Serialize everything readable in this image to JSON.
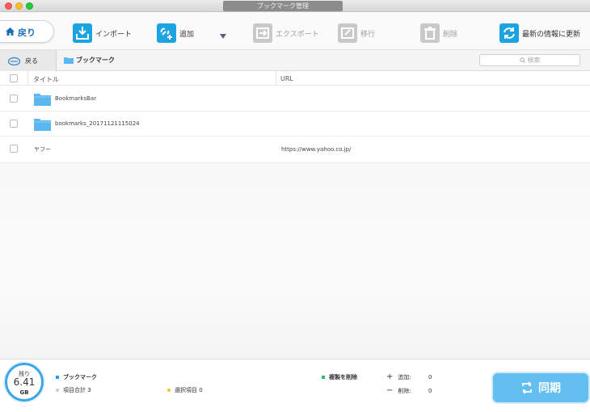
{
  "window": {
    "title": "ブックマーク管理"
  },
  "toolbar": {
    "back_label": "戻り",
    "import_label": "インポート",
    "add_label": "追加",
    "export_label": "エクスポート",
    "move_label": "移行",
    "delete_label": "削除",
    "refresh_label": "最新の情報に更新"
  },
  "nav": {
    "back_label": "戻る",
    "breadcrumb": "ブックマーク",
    "search_placeholder": "検索"
  },
  "table": {
    "columns": [
      "タイトル",
      "URL"
    ],
    "rows": [
      {
        "title": "BookmarksBar",
        "url": "",
        "type": "folder"
      },
      {
        "title": "bookmarks_20171121115024",
        "url": "",
        "type": "folder"
      },
      {
        "title": "ヤフー",
        "url": "https://www.yahoo.co.jp/",
        "type": "bookmark"
      }
    ]
  },
  "footer": {
    "storage": {
      "label": "残り",
      "value": "6.41",
      "unit": "GB"
    },
    "legend_bookmark": "ブックマーク",
    "item_total_label": "項目合計",
    "item_total": "3",
    "selected_label": "選択項目",
    "selected": "0",
    "duplicate_delete_label": "複製を削除",
    "add_count_label": "追加:",
    "add_count": "0",
    "delete_count_label": "削除:",
    "delete_count": "0",
    "sync_label": "同期"
  },
  "colors": {
    "accent": "#1ca3e2",
    "sync_button": "#63bff0",
    "bookmark_dot": "#1ca3e2",
    "item_total_dot": "#cccccc",
    "selected_dot": "#f5c518",
    "duplicate_dot": "#2ebd6b"
  }
}
